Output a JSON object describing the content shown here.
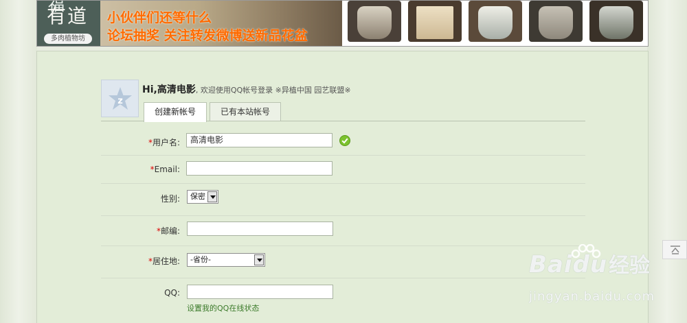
{
  "banner": {
    "logo_top": "福",
    "logo_main": "有道",
    "logo_sub": "多肉植物坊",
    "promo_line1": "小伙伴们还等什么",
    "promo_line2": "论坛抽奖  关注转发微博送新品花盆"
  },
  "greeting": {
    "hi": "Hi,高清电影",
    "message": ", 欢迎使用QQ帐号登录 ※异植中国 园艺联盟※"
  },
  "tabs": [
    {
      "label": "创建新帐号",
      "active": true
    },
    {
      "label": "已有本站帐号",
      "active": false
    }
  ],
  "form": {
    "username": {
      "label": "用户名:",
      "required": true,
      "value": "高清电影",
      "status_icon": "check-circle-icon"
    },
    "email": {
      "label": "Email:",
      "required": true,
      "value": ""
    },
    "gender": {
      "label": "性别:",
      "required": false,
      "selected": "保密"
    },
    "postcode": {
      "label": "邮编:",
      "required": true,
      "value": ""
    },
    "residence": {
      "label": "居住地:",
      "required": true,
      "selected": "-省份-"
    },
    "qq": {
      "label": "QQ:",
      "required": false,
      "value": "",
      "link": "设置我的QQ在线状态"
    }
  },
  "required_mark": "*",
  "side": {
    "icon": "back-to-top-icon"
  },
  "watermark": {
    "brand": "Bai",
    "brand_tail": "du",
    "cn": "经验",
    "url": "jingyan.baidu.com"
  },
  "colors": {
    "page_bg": "#e3edd8",
    "promo_text": "#ff6a00",
    "required": "#dd0000",
    "link": "#3b7a2a",
    "check": "#7cc22e"
  }
}
